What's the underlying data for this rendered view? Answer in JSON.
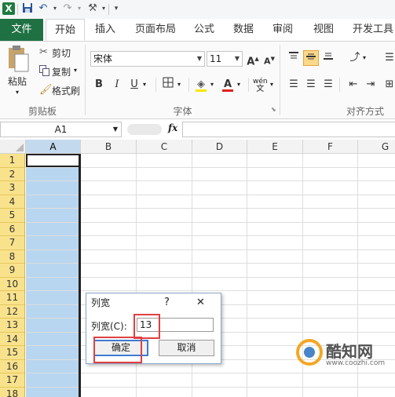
{
  "quick_access": {
    "app_icon": "X",
    "icons": [
      "save-icon",
      "undo-icon",
      "redo-icon",
      "format-painter-icon",
      "customize-icon"
    ]
  },
  "tabs": [
    "文件",
    "开始",
    "插入",
    "页面布局",
    "公式",
    "数据",
    "审阅",
    "视图",
    "开发工具"
  ],
  "ribbon": {
    "clipboard": {
      "paste": "粘贴",
      "cut": "剪切",
      "copy": "复制",
      "format_painter": "格式刷",
      "label": "剪贴板"
    },
    "font": {
      "font_name": "宋体",
      "font_size": "11",
      "bold": "B",
      "italic": "I",
      "underline": "U",
      "phonetic": "wén",
      "label": "字体"
    },
    "alignment": {
      "label": "对齐方式"
    }
  },
  "formula_bar": {
    "name_box": "A1",
    "fx": "fx"
  },
  "grid": {
    "columns": [
      "A",
      "B",
      "C",
      "D",
      "E",
      "F",
      "G"
    ],
    "rows": [
      "1",
      "2",
      "3",
      "4",
      "5",
      "6",
      "7",
      "8",
      "9",
      "10",
      "11",
      "12",
      "13",
      "14",
      "15",
      "16",
      "17",
      "18"
    ],
    "selected_column": "A"
  },
  "dialog": {
    "title": "列宽",
    "help": "?",
    "close": "✕",
    "field_label": "列宽(C):",
    "field_value": "13",
    "ok": "确定",
    "cancel": "取消"
  },
  "watermark": {
    "brand": "酷知网",
    "url": "www.coozhi.com"
  },
  "colors": {
    "file_tab": "#1f7144",
    "row_header": "#f9e28c",
    "selection": "#b8d6f0",
    "highlight": "#e04040"
  }
}
